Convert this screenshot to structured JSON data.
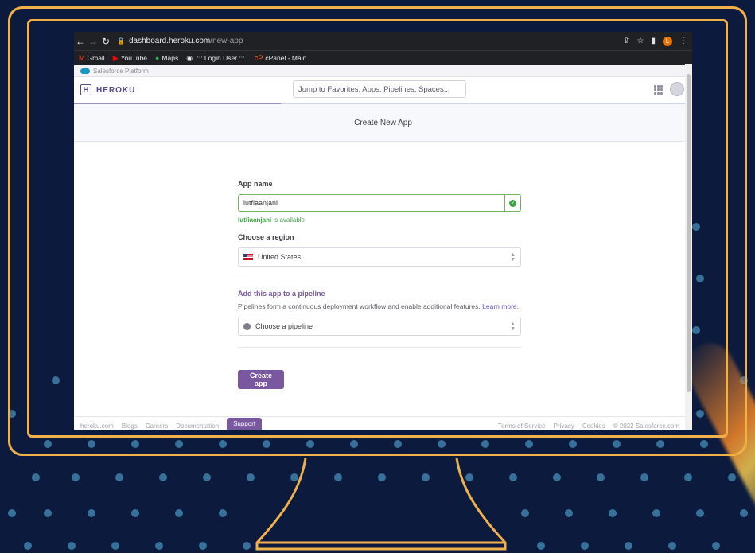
{
  "browser": {
    "url_host": "dashboard.heroku.com",
    "url_path": "/new-app",
    "profile_initial": "L",
    "bookmarks": [
      {
        "label": "Gmail",
        "icon": "gmail-icon"
      },
      {
        "label": "YouTube",
        "icon": "youtube-icon"
      },
      {
        "label": "Maps",
        "icon": "maps-icon"
      },
      {
        "label": ".::: Login User :::.",
        "icon": "globe-icon"
      },
      {
        "label": "cPanel - Main",
        "icon": "cpanel-icon"
      }
    ]
  },
  "salesforce_bar": {
    "label": "Salesforce Platform"
  },
  "header": {
    "logo_text": "HEROKU",
    "logo_letter": "H",
    "search_placeholder": "Jump to Favorites, Apps, Pipelines, Spaces..."
  },
  "page": {
    "title": "Create New App"
  },
  "form": {
    "app_name_label": "App name",
    "app_name_value": "lutfiaanjani",
    "availability_name": "lutfiaanjani",
    "availability_suffix": " is available",
    "region_label": "Choose a region",
    "region_value": "United States",
    "pipeline_title": "Add this app to a pipeline",
    "pipeline_desc": "Pipelines form a continuous deployment workflow and enable additional features.",
    "learn_more": "Learn more.",
    "pipeline_placeholder": "Choose a pipeline",
    "create_button": "Create app"
  },
  "footer": {
    "left_links": [
      "heroku.com",
      "Blogs",
      "Careers",
      "Documentation"
    ],
    "support": "Support",
    "right_links": [
      "Terms of Service",
      "Privacy",
      "Cookies",
      "© 2022 Salesforce.com"
    ]
  },
  "colors": {
    "accent": "#79589f",
    "frame": "#f2b04a",
    "background": "#0c1b3d",
    "success": "#3ea547"
  }
}
